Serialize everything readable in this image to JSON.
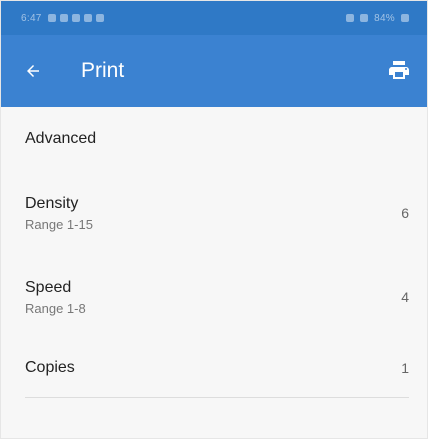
{
  "status_bar": {
    "time": "6:47",
    "battery": "84%"
  },
  "app_bar": {
    "title": "Print",
    "back_icon": "arrow-left-icon",
    "print_icon": "print-icon",
    "color": "#3b82d1"
  },
  "settings": {
    "section_title": "Advanced",
    "density": {
      "label": "Density",
      "range": "Range 1-15",
      "value": "6"
    },
    "speed": {
      "label": "Speed",
      "range": "Range 1-8",
      "value": "4"
    },
    "copies": {
      "label": "Copies",
      "value": "1"
    }
  }
}
